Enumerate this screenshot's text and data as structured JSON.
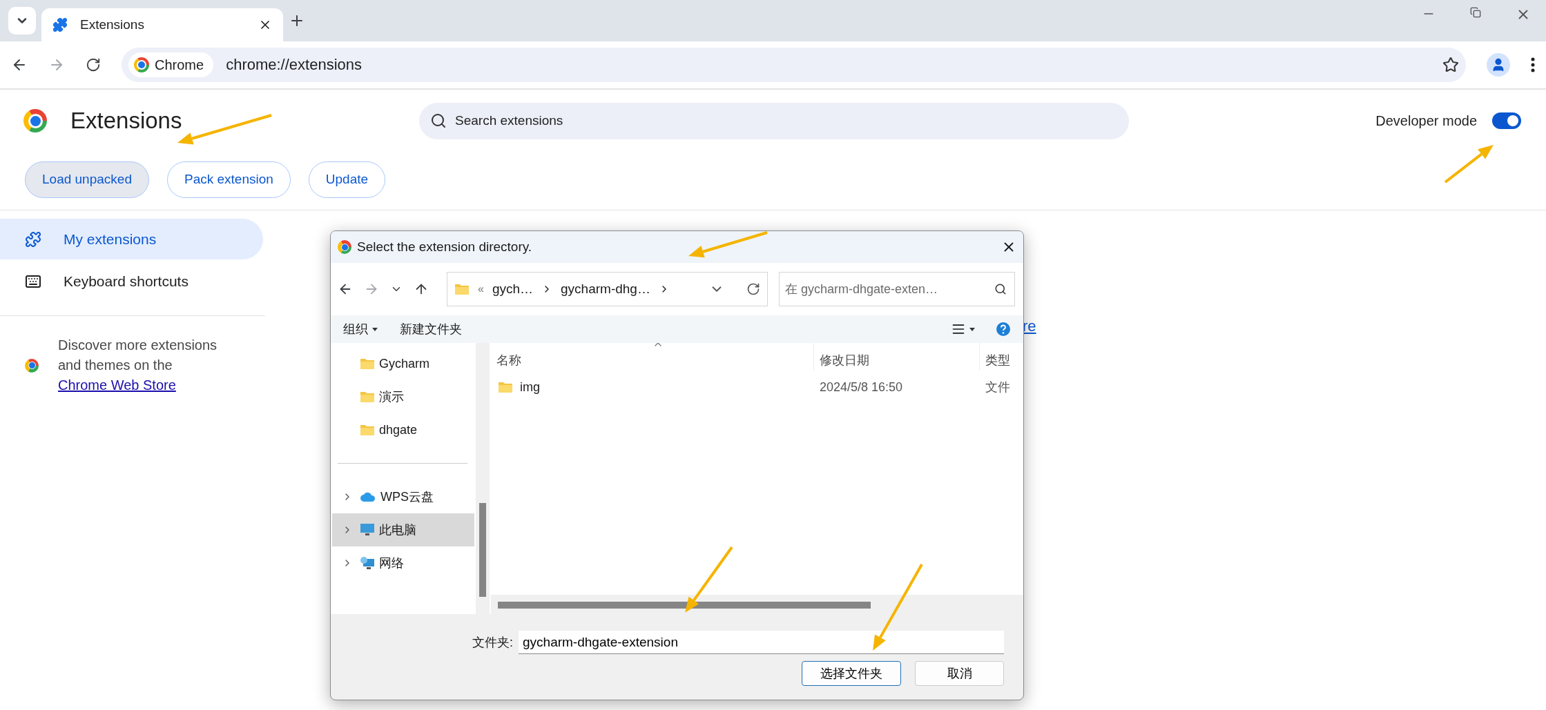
{
  "browser": {
    "tabs": [
      {
        "title": "Extensions",
        "selected": true
      }
    ],
    "nav": {
      "forward_disabled": true
    },
    "omnibox": {
      "chip": "Chrome",
      "url": "chrome://extensions"
    }
  },
  "page": {
    "title": "Extensions",
    "search": {
      "placeholder": "Search extensions"
    },
    "developer_mode": {
      "label": "Developer mode",
      "on": true
    },
    "actions": [
      {
        "label": "Load unpacked",
        "pressed": true
      },
      {
        "label": "Pack extension",
        "pressed": false
      },
      {
        "label": "Update",
        "pressed": false
      }
    ]
  },
  "sidebar": {
    "items": [
      {
        "label": "My extensions",
        "kind": "puzzle",
        "selected": true
      },
      {
        "label": "Keyboard shortcuts",
        "kind": "keyboard",
        "selected": false
      }
    ],
    "promo": {
      "text": "Discover more extensions and themes on the ",
      "link": "Chrome Web Store"
    }
  },
  "partial_link": "re",
  "dialog": {
    "title": "Select the extension directory.",
    "nav": {
      "forward_disabled": true
    },
    "path": {
      "overflow": "«",
      "crumbs": [
        "gych…",
        "gycharm-dhg…"
      ]
    },
    "search": {
      "placeholder": "在 gycharm-dhgate-exten…"
    },
    "commands": [
      {
        "label": "组织",
        "kind": "menu"
      },
      {
        "label": "新建文件夹",
        "kind": "plain"
      }
    ],
    "quick_access": [
      {
        "label": "Gycharm",
        "kind": "folder",
        "selected": false
      },
      {
        "label": "演示",
        "kind": "folder",
        "selected": false
      },
      {
        "label": "dhgate",
        "kind": "folder",
        "selected": false
      }
    ],
    "locations": [
      {
        "label": "WPS云盘",
        "kind": "cloud",
        "expanded": false,
        "selected": false
      },
      {
        "label": "此电脑",
        "kind": "pc",
        "expanded": false,
        "selected": true
      },
      {
        "label": "网络",
        "kind": "network",
        "expanded": false,
        "selected": false
      }
    ],
    "columns": [
      {
        "label": "名称",
        "sorted": true
      },
      {
        "label": "修改日期",
        "sorted": false
      },
      {
        "label": "类型",
        "sorted": false
      }
    ],
    "rows": [
      {
        "name": "img",
        "modified": "2024/5/8 16:50",
        "type": "文件"
      }
    ],
    "folder_field": {
      "label": "文件夹:",
      "value": "gycharm-dhgate-extension"
    },
    "buttons": [
      {
        "label": "选择文件夹",
        "default": true
      },
      {
        "label": "取消",
        "default": false
      }
    ]
  }
}
